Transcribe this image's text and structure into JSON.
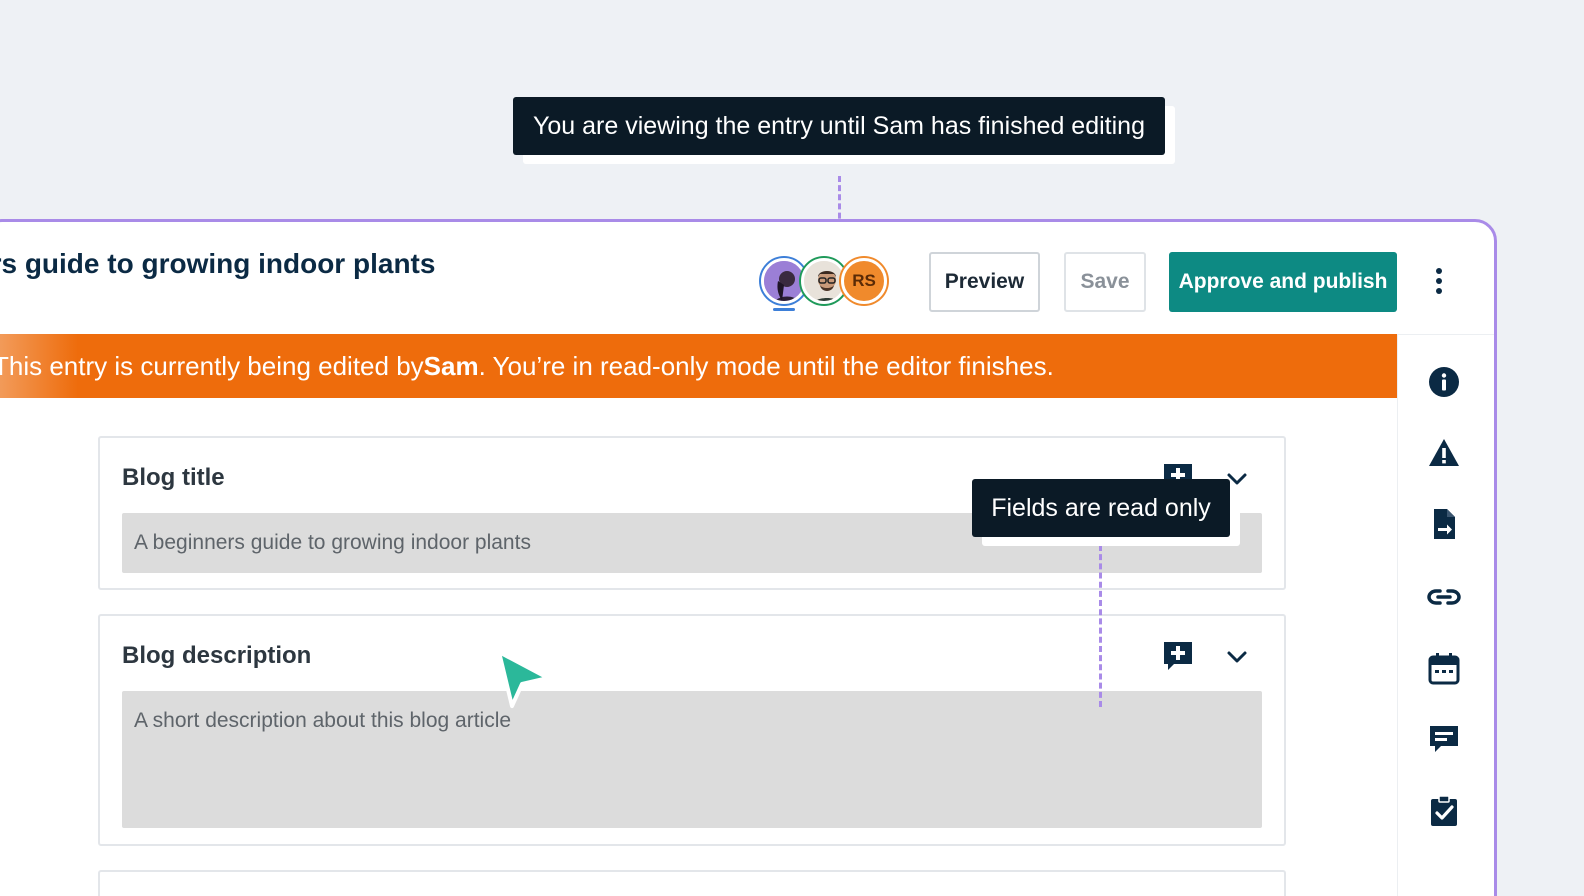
{
  "tooltips": {
    "viewing": "You are viewing the entry until Sam has finished editing",
    "read_only": "Fields are read only"
  },
  "header": {
    "title": "ers guide to growing indoor plants",
    "collaborators": [
      {
        "name": "avatar-1",
        "initials": ""
      },
      {
        "name": "avatar-2",
        "initials": ""
      },
      {
        "name": "avatar-3",
        "initials": "RS"
      }
    ],
    "buttons": {
      "preview": "Preview",
      "save": "Save",
      "publish": "Approve and publish"
    }
  },
  "banner": {
    "text_before": "This entry is currently being edited by ",
    "editor": "Sam",
    "text_after": ". You’re in read-only mode until the editor finishes."
  },
  "fields": {
    "blog_title": {
      "label": "Blog title",
      "value": "A beginners guide to growing indoor plants"
    },
    "blog_description": {
      "label": "Blog description",
      "placeholder": "A short description about this blog article"
    }
  },
  "sidebar": {
    "icons": [
      "info-icon",
      "warning-icon",
      "document-export-icon",
      "link-icon",
      "calendar-icon",
      "comment-icon",
      "clipboard-check-icon"
    ]
  },
  "colors": {
    "accent": "#0d8a83",
    "banner": "#ee6c0c",
    "frame": "#a98be8",
    "dark": "#0b2a44"
  }
}
